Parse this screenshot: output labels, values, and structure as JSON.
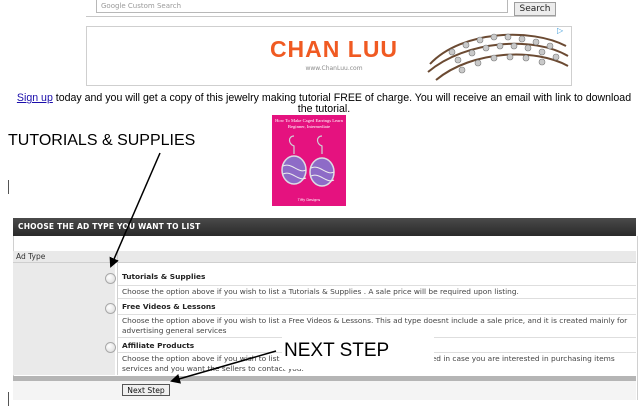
{
  "search": {
    "placeholder": "Google  Custom Search",
    "button_label": "Search"
  },
  "ad": {
    "brand": "CHAN LUU",
    "url": "www.ChanLuu.com",
    "choices_icon": "play-triangle-icon",
    "brand_color": "#f05a22"
  },
  "signup": {
    "link": "Sign up",
    "text": " today and you will get a copy of this jewelry making tutorial FREE of charge. You will receive an email with link to download the tutorial."
  },
  "book": {
    "title": "How To Make Caged Earrings Learn Beginner, Intermediate",
    "footer": "Tiffy Designs",
    "color": "#e5127f"
  },
  "annotations": {
    "tutorials": "TUTORIALS & SUPPLIES",
    "next_step": "NEXT STEP"
  },
  "panel": {
    "title": "CHOOSE THE AD TYPE YOU WANT TO LIST",
    "column_label": "Ad Type",
    "options": [
      {
        "label": "Tutorials & Supplies",
        "desc": "Choose the option above if you wish to list a Tutorials & Supplies . A sale price will be required upon listing."
      },
      {
        "label": "Free Videos & Lessons",
        "desc": "Choose the option above if you wish to list a Free Videos & Lessons. This ad type doesnt include a sale price, and it is created mainly for advertising general services"
      },
      {
        "label": "Affiliate Products",
        "desc": "Choose the option above if you wish to list an Affiliate Product. This ad type is created in case you are interested in purchasing items services and you want the sellers to contact you."
      }
    ],
    "next_button": "Next Step"
  }
}
